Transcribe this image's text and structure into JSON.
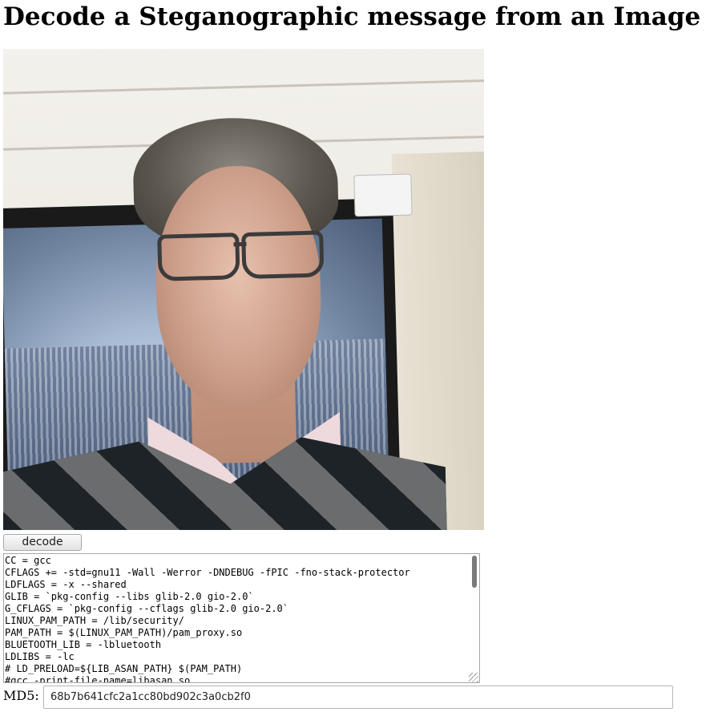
{
  "page": {
    "title": "Decode a Steganographic message from an Image"
  },
  "image": {
    "description_icon": "photo-portrait"
  },
  "controls": {
    "decode_label": "decode"
  },
  "output": {
    "text": "CC = gcc\nCFLAGS += -std=gnu11 -Wall -Werror -DNDEBUG -fPIC -fno-stack-protector\nLDFLAGS = -x --shared\nGLIB = `pkg-config --libs glib-2.0 gio-2.0`\nG_CFLAGS = `pkg-config --cflags glib-2.0 gio-2.0`\nLINUX_PAM_PATH = /lib/security/\nPAM_PATH = $(LINUX_PAM_PATH)/pam_proxy.so\nBLUETOOTH_LIB = -lbluetooth\nLDLIBS = -lc\n# LD_PRELOAD=${LIB_ASAN_PATH} $(PAM_PATH)\n#gcc -print-file-name=libasan.so"
  },
  "md5": {
    "label": "MD5:",
    "value": "68b7b641cfc2a1cc80bd902c3a0cb2f0"
  }
}
